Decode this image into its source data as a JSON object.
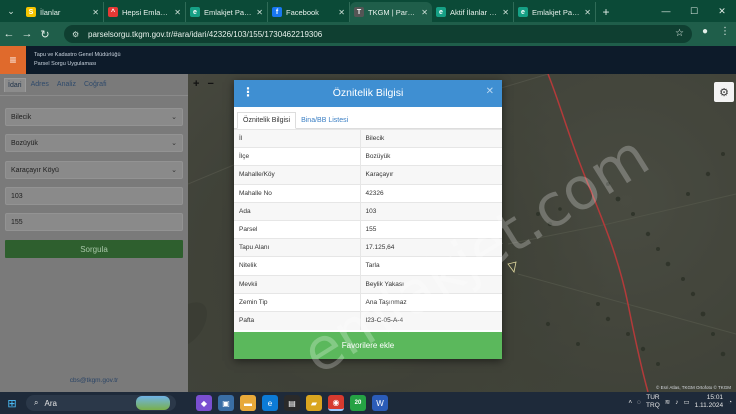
{
  "browser": {
    "tabs": [
      {
        "title": "İlanlar",
        "icon": "sahibinden-icon",
        "color": "#f5c400",
        "glyph": "S",
        "active": false
      },
      {
        "title": "Hepsi Emlak Ba",
        "icon": "hepsiemlak-icon",
        "color": "#e53935",
        "glyph": "^",
        "active": false
      },
      {
        "title": "Emlakjet Panel",
        "icon": "emlakjet-icon",
        "color": "#16a085",
        "glyph": "e",
        "active": false
      },
      {
        "title": "Facebook",
        "icon": "facebook-icon",
        "color": "#1877f2",
        "glyph": "f",
        "active": false
      },
      {
        "title": "TKGM | Parsel Sor",
        "icon": "tkgm-icon",
        "color": "#555",
        "glyph": "T",
        "active": true
      },
      {
        "title": "Aktif İlanlar - Em",
        "icon": "emlakjet-icon",
        "color": "#16a085",
        "glyph": "e",
        "active": false
      },
      {
        "title": "Emlakjet Panel",
        "icon": "emlakjet-icon",
        "color": "#16a085",
        "glyph": "e",
        "active": false
      }
    ],
    "url": "parselsorgu.tkgm.gov.tr/#ara/idari/42326/103/155/1730462219306"
  },
  "app": {
    "title_line1": "Tapu ve Kadastro Genel Müdürlüğü",
    "title_line2": "Parsel Sorgu Uygulaması"
  },
  "sidebar": {
    "tabs": [
      "İdari",
      "Adres",
      "Analiz",
      "Coğrafi"
    ],
    "province": "Bilecik",
    "district": "Bozüyük",
    "neighborhood": "Karaçayır Köyü",
    "block": "103",
    "parcel": "155",
    "query_button": "Sorgula",
    "email": "cbs@tkgm.gov.tr"
  },
  "modal": {
    "title": "Öznitelik Bilgisi",
    "tabs": [
      "Öznitelik Bilgisi",
      "Bina/BB Listesi"
    ],
    "rows": [
      {
        "label": "İl",
        "value": "Bilecik"
      },
      {
        "label": "İlçe",
        "value": "Bozüyük"
      },
      {
        "label": "Mahalle/Köy",
        "value": "Karaçayır"
      },
      {
        "label": "Mahalle No",
        "value": "42326"
      },
      {
        "label": "Ada",
        "value": "103"
      },
      {
        "label": "Parsel",
        "value": "155"
      },
      {
        "label": "Tapu Alanı",
        "value": "17.125,64"
      },
      {
        "label": "Nitelik",
        "value": "Tarla"
      },
      {
        "label": "Mevkii",
        "value": "Beylik Yakası"
      },
      {
        "label": "Zemin Tip",
        "value": "Ana Taşınmaz"
      },
      {
        "label": "Pafta",
        "value": "I23-C-05-A-4"
      }
    ],
    "favorite_button": "Favorilere ekle"
  },
  "map": {
    "attribution": "© Esri Atlas, TKGM Ortofoto © TKGM"
  },
  "watermark": "emlakjet.com",
  "taskbar": {
    "search_placeholder": "Ara",
    "weather_badge": "20",
    "lang_top": "TUR",
    "lang_bottom": "TRQ",
    "time": "15:01",
    "date": "1.11.2024"
  }
}
